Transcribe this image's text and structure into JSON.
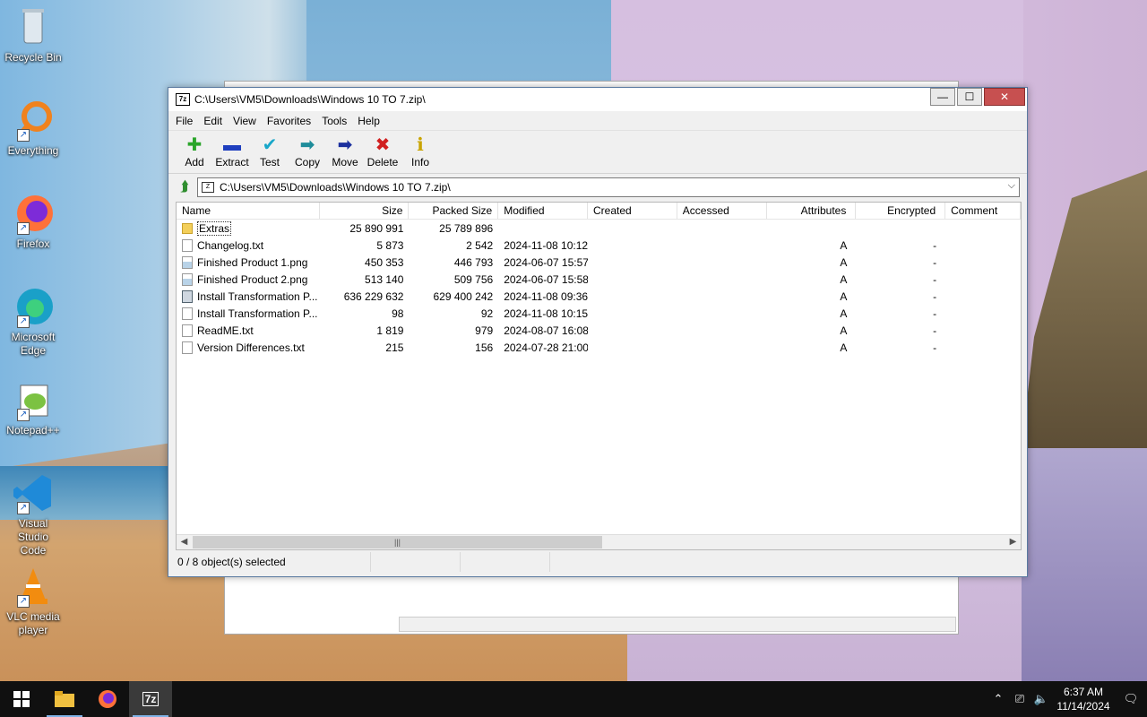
{
  "desktop": {
    "icons": [
      {
        "label": "Recycle Bin",
        "icon": "recycle-bin-icon"
      },
      {
        "label": "Everything",
        "icon": "everything-search-icon"
      },
      {
        "label": "Firefox",
        "icon": "firefox-icon"
      },
      {
        "label": "Microsoft Edge",
        "icon": "edge-icon"
      },
      {
        "label": "Notepad++",
        "icon": "notepad-plus-plus-icon"
      },
      {
        "label": "Visual Studio Code",
        "icon": "vscode-icon"
      },
      {
        "label": "VLC media player",
        "icon": "vlc-icon"
      }
    ]
  },
  "window": {
    "app_icon": "7z",
    "title": "C:\\Users\\VM5\\Downloads\\Windows 10 TO 7.zip\\",
    "minimize": "—",
    "maximize": "☐",
    "close": "✕"
  },
  "menu": [
    "File",
    "Edit",
    "View",
    "Favorites",
    "Tools",
    "Help"
  ],
  "toolbar": [
    {
      "label": "Add",
      "glyph": "✚",
      "color": "#2aa52a"
    },
    {
      "label": "Extract",
      "glyph": "▬",
      "color": "#1f3fbf"
    },
    {
      "label": "Test",
      "glyph": "✔",
      "color": "#19a7c9"
    },
    {
      "label": "Copy",
      "glyph": "➡",
      "color": "#1e8c9a"
    },
    {
      "label": "Move",
      "glyph": "➡",
      "color": "#1b2f9e"
    },
    {
      "label": "Delete",
      "glyph": "✖",
      "color": "#d11f1f"
    },
    {
      "label": "Info",
      "glyph": "ℹ",
      "color": "#c9a400"
    }
  ],
  "address": {
    "path": "C:\\Users\\VM5\\Downloads\\Windows 10 TO 7.zip\\"
  },
  "columns": [
    "Name",
    "Size",
    "Packed Size",
    "Modified",
    "Created",
    "Accessed",
    "Attributes",
    "Encrypted",
    "Comment"
  ],
  "files": [
    {
      "name": "Extras",
      "type": "folder",
      "size": "25 890 991",
      "packed": "25 789 896",
      "modified": "",
      "created": "",
      "accessed": "",
      "attributes": "",
      "encrypted": "",
      "comment": ""
    },
    {
      "name": "Changelog.txt",
      "type": "text",
      "size": "5 873",
      "packed": "2 542",
      "modified": "2024-11-08 10:12",
      "created": "",
      "accessed": "",
      "attributes": "A",
      "encrypted": "-",
      "comment": ""
    },
    {
      "name": "Finished Product 1.png",
      "type": "image",
      "size": "450 353",
      "packed": "446 793",
      "modified": "2024-06-07 15:57",
      "created": "",
      "accessed": "",
      "attributes": "A",
      "encrypted": "-",
      "comment": ""
    },
    {
      "name": "Finished Product 2.png",
      "type": "image",
      "size": "513 140",
      "packed": "509 756",
      "modified": "2024-06-07 15:58",
      "created": "",
      "accessed": "",
      "attributes": "A",
      "encrypted": "-",
      "comment": ""
    },
    {
      "name": "Install Transformation P...",
      "type": "app",
      "size": "636 229 632",
      "packed": "629 400 242",
      "modified": "2024-11-08 09:36",
      "created": "",
      "accessed": "",
      "attributes": "A",
      "encrypted": "-",
      "comment": ""
    },
    {
      "name": "Install Transformation P...",
      "type": "text",
      "size": "98",
      "packed": "92",
      "modified": "2024-11-08 10:15",
      "created": "",
      "accessed": "",
      "attributes": "A",
      "encrypted": "-",
      "comment": ""
    },
    {
      "name": "ReadME.txt",
      "type": "text",
      "size": "1 819",
      "packed": "979",
      "modified": "2024-08-07 16:08",
      "created": "",
      "accessed": "",
      "attributes": "A",
      "encrypted": "-",
      "comment": ""
    },
    {
      "name": "Version Differences.txt",
      "type": "text",
      "size": "215",
      "packed": "156",
      "modified": "2024-07-28 21:00",
      "created": "",
      "accessed": "",
      "attributes": "A",
      "encrypted": "-",
      "comment": ""
    }
  ],
  "status": {
    "selection": "0 / 8 object(s) selected"
  },
  "taskbar": {
    "start_icon": "windows-start-icon",
    "apps": [
      {
        "icon": "file-explorer-icon",
        "active": false
      },
      {
        "icon": "firefox-icon",
        "active": false
      },
      {
        "icon": "7zip-icon",
        "label": "7z",
        "active": true
      }
    ],
    "time": "6:37 AM",
    "date": "11/14/2024"
  }
}
